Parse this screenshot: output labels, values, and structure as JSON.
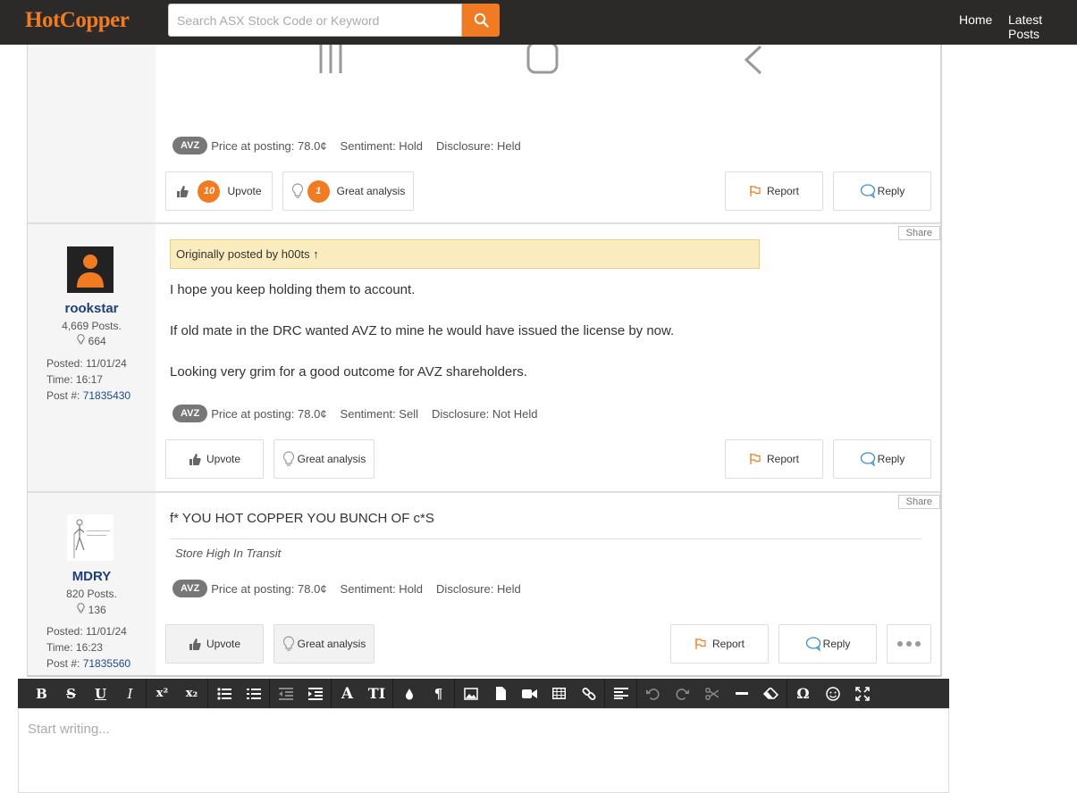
{
  "header": {
    "logo": "HotCopper",
    "search_placeholder": "Search ASX Stock Code or Keyword",
    "nav": [
      "Home",
      "Latest Posts"
    ]
  },
  "posts": [
    {
      "tag": "AVZ",
      "price": "Price at posting: 78.0¢",
      "sentiment": "Sentiment: Hold",
      "disclosure": "Disclosure: Held",
      "upvote_count": "10",
      "upvote_label": "Upvote",
      "analysis_count": "1",
      "analysis_label": "Great analysis",
      "report_label": "Report",
      "reply_label": "Reply"
    },
    {
      "share_label": "Share",
      "username": "rookstar",
      "posts_count": "4,669 Posts.",
      "likes": "664",
      "posted": "Posted: 11/01/24",
      "time": "Time: 16:17",
      "post_no_label": "Post #:",
      "post_no": "71835430",
      "quote": "Originally posted by h00ts ↑",
      "paragraphs": [
        "I hope you keep holding them to account.",
        "If old mate in the DRC wanted AVZ to mine he would have issued the license by now.",
        "Looking very grim for a good outcome for AVZ shareholders."
      ],
      "tag": "AVZ",
      "price": "Price at posting: 78.0¢",
      "sentiment": "Sentiment: Sell",
      "disclosure": "Disclosure: Not Held",
      "upvote_label": "Upvote",
      "analysis_label": "Great analysis",
      "report_label": "Report",
      "reply_label": "Reply"
    },
    {
      "share_label": "Share",
      "username": "MDRY",
      "posts_count": "820 Posts.",
      "likes": "136",
      "posted": "Posted: 11/01/24",
      "time": "Time: 16:23",
      "post_no_label": "Post #:",
      "post_no": "71835560",
      "text": "f* YOU HOT COPPER YOU BUNCH OF c*S",
      "signature": "Store High In Transit",
      "tag": "AVZ",
      "price": "Price at posting: 78.0¢",
      "sentiment": "Sentiment: Hold",
      "disclosure": "Disclosure: Held",
      "upvote_label": "Upvote",
      "analysis_label": "Great analysis",
      "report_label": "Report",
      "reply_label": "Reply"
    }
  ],
  "editor": {
    "placeholder": "Start writing...",
    "toolbar": [
      "bold",
      "strikethrough",
      "underline",
      "italic",
      "superscript",
      "subscript",
      "bullet-list",
      "numbered-list",
      "outdent",
      "indent",
      "font-color",
      "font-size",
      "color-fill",
      "paragraph",
      "image",
      "file",
      "video",
      "table",
      "link",
      "align",
      "undo",
      "redo",
      "cut",
      "horizontal-rule",
      "clear-format",
      "special-char",
      "emoticon",
      "fullscreen"
    ]
  },
  "colors": {
    "brand": "#f07b22",
    "header_bg": "#2b2a29",
    "username": "#1e3f78",
    "quote_bg": "#faecbe"
  }
}
